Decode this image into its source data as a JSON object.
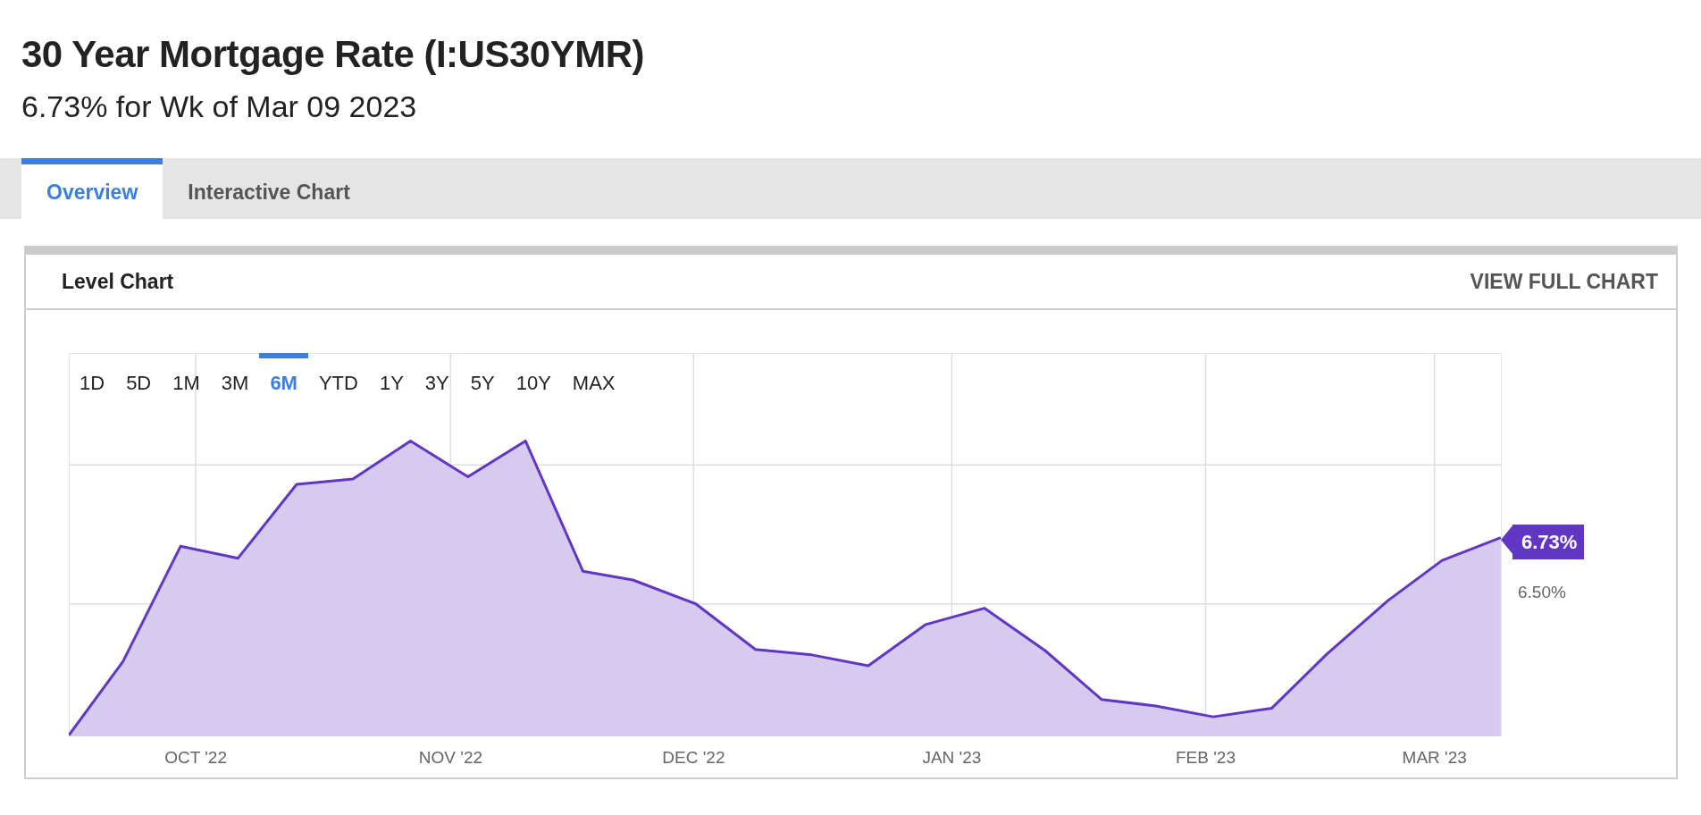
{
  "header": {
    "title": "30 Year Mortgage Rate (I:US30YMR)",
    "subtitle": "6.73% for Wk of Mar 09 2023"
  },
  "tabs": [
    {
      "label": "Overview",
      "selected": true
    },
    {
      "label": "Interactive Chart",
      "selected": false
    }
  ],
  "card": {
    "title": "Level Chart",
    "link": "VIEW FULL CHART",
    "ranges": [
      {
        "label": "1D",
        "selected": false
      },
      {
        "label": "5D",
        "selected": false
      },
      {
        "label": "1M",
        "selected": false
      },
      {
        "label": "3M",
        "selected": false
      },
      {
        "label": "6M",
        "selected": true
      },
      {
        "label": "YTD",
        "selected": false
      },
      {
        "label": "1Y",
        "selected": false
      },
      {
        "label": "3Y",
        "selected": false
      },
      {
        "label": "5Y",
        "selected": false
      },
      {
        "label": "10Y",
        "selected": false
      },
      {
        "label": "MAX",
        "selected": false
      }
    ],
    "latest_value": "6.73%",
    "y_axis_label": "6.50%",
    "x_axis_labels": [
      "OCT '22",
      "NOV '22",
      "DEC '22",
      "JAN '23",
      "FEB '23",
      "MAR '23"
    ]
  }
}
